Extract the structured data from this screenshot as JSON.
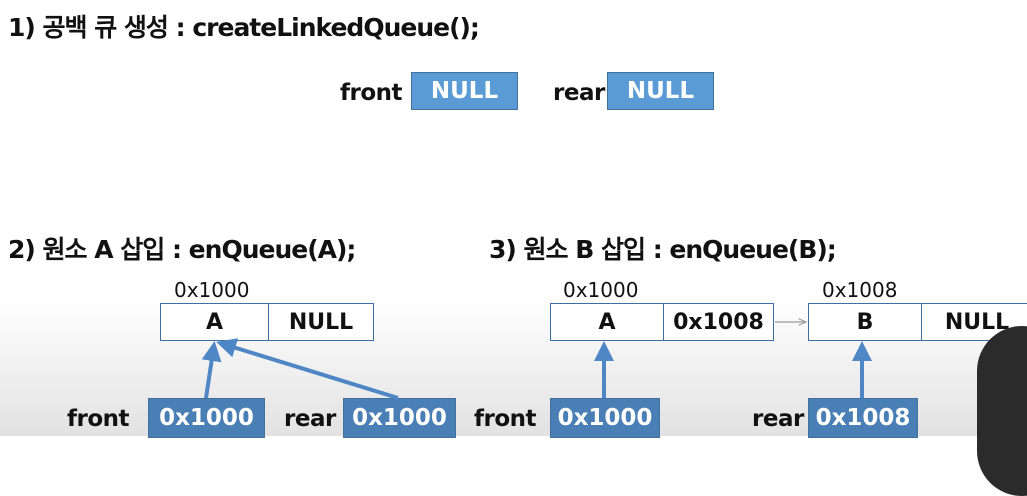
{
  "section1": {
    "heading": "1) 공백 큐 생성 : createLinkedQueue();",
    "front_label": "front",
    "front_value": "NULL",
    "rear_label": "rear",
    "rear_value": "NULL"
  },
  "section2": {
    "heading": "2) 원소 A 삽입 : enQueue(A);",
    "node_address": "0x1000",
    "node_data": "A",
    "node_link": "NULL",
    "front_label": "front",
    "front_value": "0x1000",
    "rear_label": "rear",
    "rear_value": "0x1000"
  },
  "section3": {
    "heading": "3) 원소 B 삽입 : enQueue(B);",
    "node1_address": "0x1000",
    "node1_data": "A",
    "node1_link": "0x1008",
    "node2_address": "0x1008",
    "node2_data": "B",
    "node2_link": "NULL",
    "front_label": "front",
    "front_value": "0x1000",
    "rear_label": "rear",
    "rear_value": "0x1008"
  },
  "colors": {
    "pointer_box": "#5b9bd5",
    "pointer_box_dark": "#4a7fb5",
    "node_border": "#3c6fa8",
    "arrow": "#4f86c6"
  }
}
